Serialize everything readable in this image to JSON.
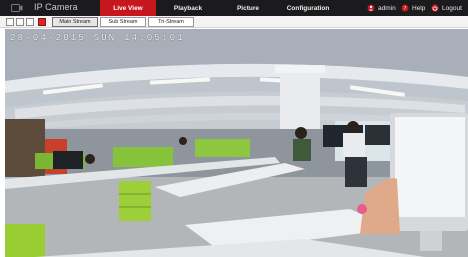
{
  "header": {
    "app_title": "IP Camera",
    "tabs": [
      {
        "label": "Live View",
        "active": true
      },
      {
        "label": "Playback",
        "active": false
      },
      {
        "label": "Picture",
        "active": false
      },
      {
        "label": "Configuration",
        "active": false
      }
    ],
    "user": {
      "label": "admin",
      "icon": "user-icon"
    },
    "help": {
      "label": "Help",
      "icon": "help-icon"
    },
    "logout": {
      "label": "Logout",
      "icon": "logout-icon"
    },
    "accent_color": "#c5171d",
    "bar_color": "#1b1b1d"
  },
  "toolbar": {
    "icons": [
      "layout-single-icon",
      "layout-quad-icon",
      "fullscreen-icon",
      "record-icon"
    ],
    "streams": [
      {
        "label": "Main Stream",
        "active": true
      },
      {
        "label": "Sub Stream",
        "active": false
      },
      {
        "label": "Tri-Stream",
        "active": false
      }
    ]
  },
  "video": {
    "osd_timestamp": "28-04-2015 SUN 14:05:01",
    "scene": "office-camera-feed"
  }
}
